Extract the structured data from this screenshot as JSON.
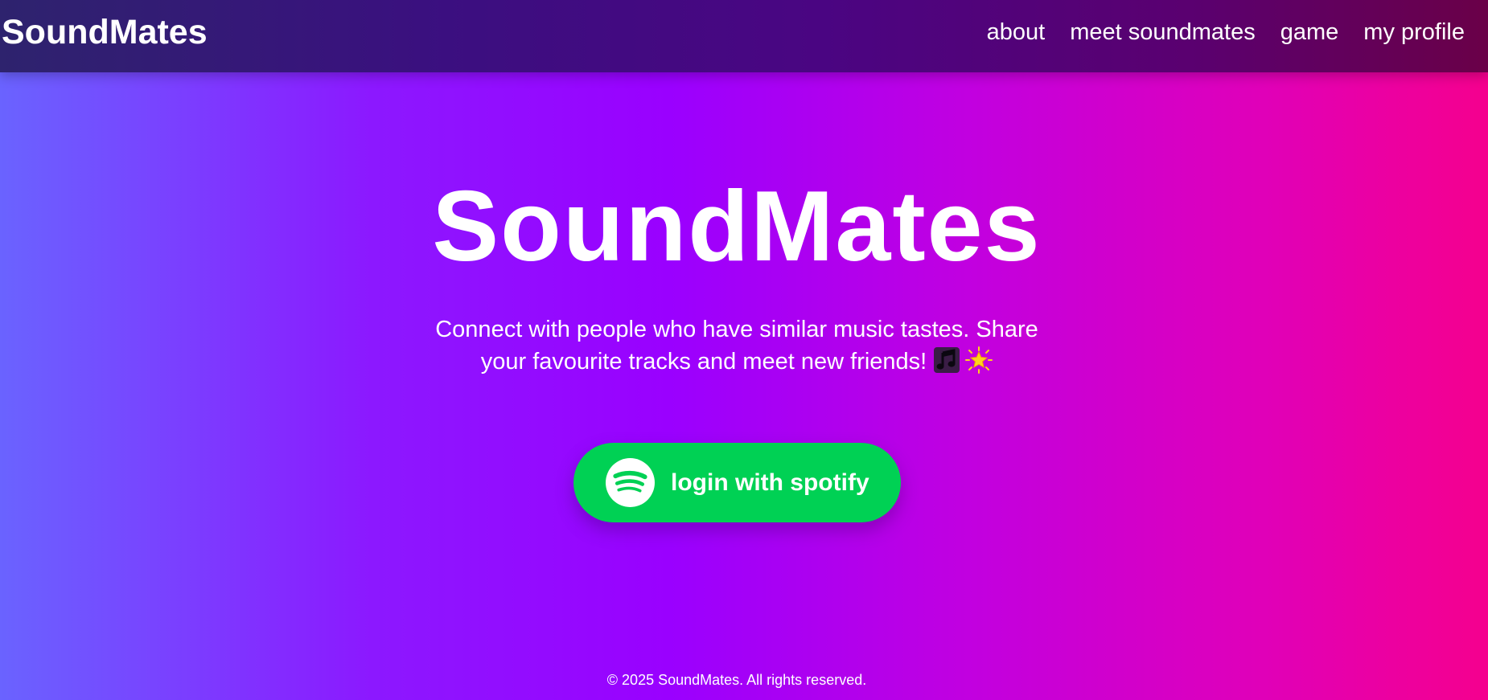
{
  "header": {
    "brand": "SoundMates",
    "nav": [
      {
        "label": "about"
      },
      {
        "label": "meet soundmates"
      },
      {
        "label": "game"
      },
      {
        "label": "my profile"
      }
    ]
  },
  "hero": {
    "title": "SoundMates",
    "tagline": "Connect with people who have similar music tastes. Share your favourite tracks and meet new friends!",
    "tagline_icons": [
      "music-note-icon",
      "glowing-star-icon"
    ],
    "login_button": {
      "label": "login with spotify",
      "icon": "spotify-icon"
    }
  },
  "footer": {
    "text": "© 2025 SoundMates. All rights reserved."
  },
  "colors": {
    "spotify_green": "#00d154",
    "gradient_start": "#6a63ff",
    "gradient_mid": "#9a00ff",
    "gradient_end": "#f5008e",
    "nav_background": "#3b0f80"
  }
}
